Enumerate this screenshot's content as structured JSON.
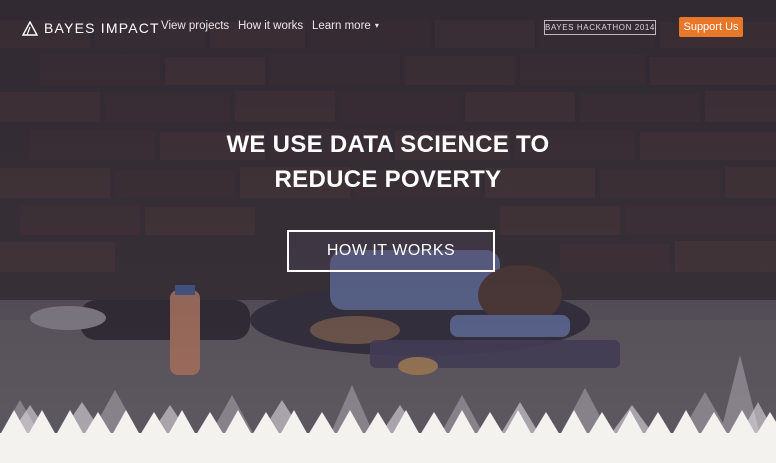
{
  "brand": {
    "name": "BAYES IMPACT",
    "logo_icon": "triangle-logo-icon"
  },
  "nav": {
    "links": [
      {
        "label": "View projects"
      },
      {
        "label": "How it works"
      },
      {
        "label": "Learn more"
      }
    ],
    "learn_more_caret": "▾",
    "hackathon_label": "BAYES HACKATHON 2014",
    "support_label": "Support Us"
  },
  "hero": {
    "headline_line1": "WE USE DATA SCIENCE TO",
    "headline_line2": "REDUCE POVERTY",
    "cta_label": "HOW IT WORKS"
  },
  "colors": {
    "accent": "#e9772a",
    "overlay": "#3a3248",
    "light_bg": "#f4f2ef"
  }
}
